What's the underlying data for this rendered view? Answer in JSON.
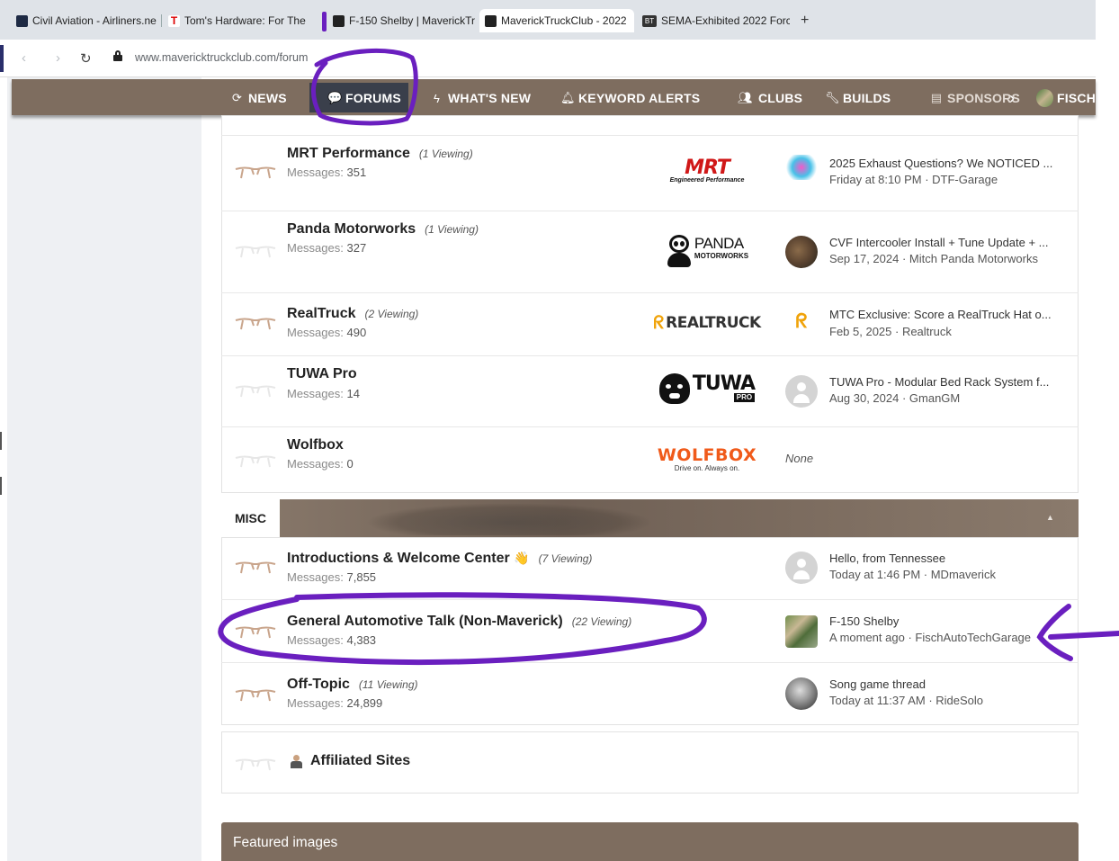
{
  "browser": {
    "tabs": [
      {
        "label": "Civil Aviation - Airliners.ne",
        "active": false
      },
      {
        "label": "Tom's Hardware: For The H",
        "active": false
      },
      {
        "label": "F-150 Shelby | MaverickTr",
        "active": false
      },
      {
        "label": "MaverickTruckClub - 2022",
        "active": true
      },
      {
        "label": "SEMA-Exhibited 2022 Forc",
        "active": false
      }
    ],
    "new_tab": "+",
    "url": "www.mavericktruckclub.com/forum"
  },
  "site_nav": {
    "items": [
      {
        "label": "NEWS",
        "icon": "news-icon"
      },
      {
        "label": "FORUMS",
        "icon": "forums-icon"
      },
      {
        "label": "WHAT'S NEW",
        "icon": "bolt-icon"
      },
      {
        "label": "KEYWORD ALERTS",
        "icon": "bell-icon"
      },
      {
        "label": "CLUBS",
        "icon": "users-icon"
      },
      {
        "label": "BUILDS",
        "icon": "wrench-icon"
      },
      {
        "label": "SPONSORS",
        "icon": "sponsors-icon"
      },
      {
        "label": "FISCH",
        "icon": "avatar"
      }
    ],
    "scroll_arrow": "›"
  },
  "sponsor_forums": [
    {
      "title": "MRT Performance",
      "viewing": "(1 Viewing)",
      "messages_label": "Messages:",
      "messages": "351",
      "logo_text": "MRT",
      "logo_sub": "Engineered Performance",
      "last_post_title": "2025 Exhaust Questions? We NOTICED ...",
      "last_post_meta": "Friday at 8:10 PM · DTF-Garage"
    },
    {
      "title": "Panda Motorworks",
      "viewing": "(1 Viewing)",
      "messages_label": "Messages:",
      "messages": "327",
      "logo_text": "PANDA",
      "logo_sub": "MOTORWORKS",
      "last_post_title": "CVF Intercooler Install + Tune Update + ...",
      "last_post_meta": "Sep 17, 2024 · Mitch Panda Motorworks"
    },
    {
      "title": "RealTruck",
      "viewing": "(2 Viewing)",
      "messages_label": "Messages:",
      "messages": "490",
      "logo_text": "REALTRUCK",
      "last_post_title": "MTC Exclusive: Score a RealTruck Hat o...",
      "last_post_meta": "Feb 5, 2025 · Realtruck"
    },
    {
      "title": "TUWA Pro",
      "viewing": "",
      "messages_label": "Messages:",
      "messages": "14",
      "logo_text": "TUWA",
      "logo_sub": "PRO",
      "last_post_title": "TUWA Pro - Modular Bed Rack System f...",
      "last_post_meta": "Aug 30, 2024 · GmanGM"
    },
    {
      "title": "Wolfbox",
      "viewing": "",
      "messages_label": "Messages:",
      "messages": "0",
      "logo_text": "WOLFBOX",
      "logo_sub": "Drive on. Always on.",
      "last_post_none": "None"
    }
  ],
  "misc": {
    "header": "MISC",
    "collapse_icon": "▲",
    "forums": [
      {
        "title": "Introductions & Welcome Center",
        "emoji": "👋",
        "viewing": "(7 Viewing)",
        "messages_label": "Messages:",
        "messages": "7,855",
        "last_post_title": "Hello, from Tennessee",
        "last_post_meta": "Today at 1:46 PM · MDmaverick"
      },
      {
        "title": "General Automotive Talk (Non-Maverick)",
        "viewing": "(22 Viewing)",
        "messages_label": "Messages:",
        "messages": "4,383",
        "last_post_title": "F-150 Shelby",
        "last_post_meta": "A moment ago · FischAutoTechGarage"
      },
      {
        "title": "Off-Topic",
        "viewing": "(11 Viewing)",
        "messages_label": "Messages:",
        "messages": "24,899",
        "last_post_title": "Song game thread",
        "last_post_meta": "Today at 11:37 AM · RideSolo"
      }
    ]
  },
  "affiliated": {
    "title": "Affiliated Sites"
  },
  "featured": {
    "title": "Featured images"
  },
  "colors": {
    "nav_brown": "#7e6d5f",
    "annotation_purple": "#6a1fbf",
    "forums_active": "#3a3f4b"
  }
}
